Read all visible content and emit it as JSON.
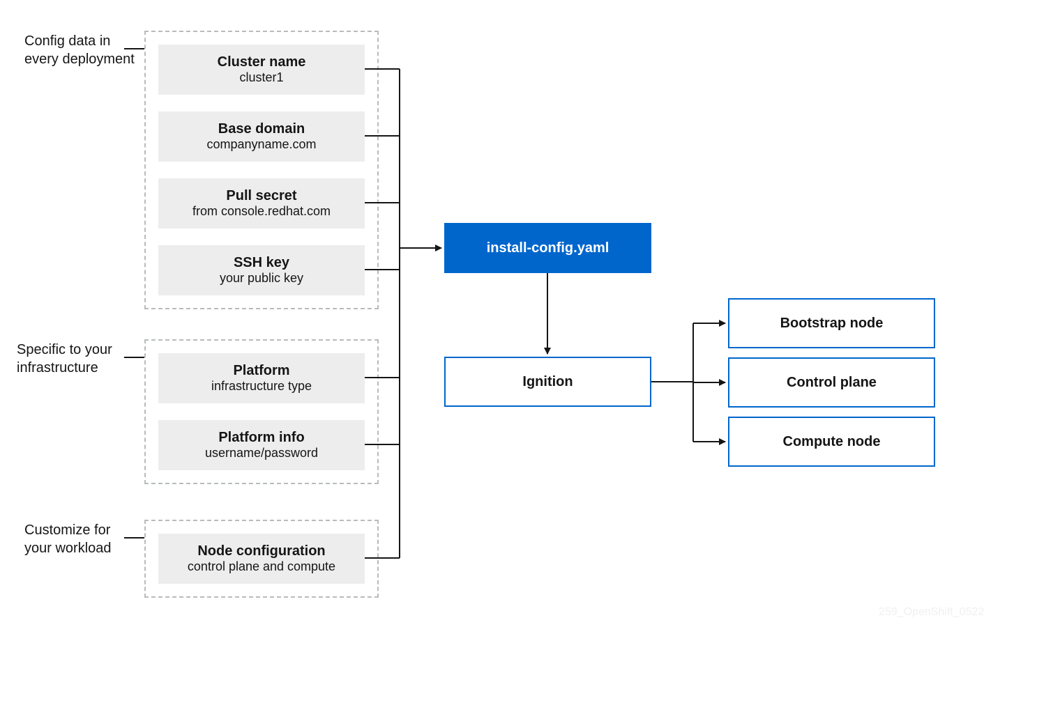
{
  "labels": {
    "group1": "Config data in\nevery deployment",
    "group2": "Specific to your\ninfrastructure",
    "group3": "Customize for\nyour workload"
  },
  "group1": {
    "items": [
      {
        "title": "Cluster name",
        "sub": "cluster1"
      },
      {
        "title": "Base domain",
        "sub": "companyname.com"
      },
      {
        "title": "Pull secret",
        "sub": "from console.redhat.com"
      },
      {
        "title": "SSH key",
        "sub": "your public key"
      }
    ]
  },
  "group2": {
    "items": [
      {
        "title": "Platform",
        "sub": "infrastructure type"
      },
      {
        "title": "Platform info",
        "sub": "username/password"
      }
    ]
  },
  "group3": {
    "items": [
      {
        "title": "Node configuration",
        "sub": "control plane and compute"
      }
    ]
  },
  "center": {
    "install": "install-config.yaml",
    "ignition": "Ignition"
  },
  "outputs": {
    "bootstrap": "Bootstrap node",
    "control": "Control plane",
    "compute": "Compute node"
  },
  "watermark": "259_OpenShift_0522"
}
